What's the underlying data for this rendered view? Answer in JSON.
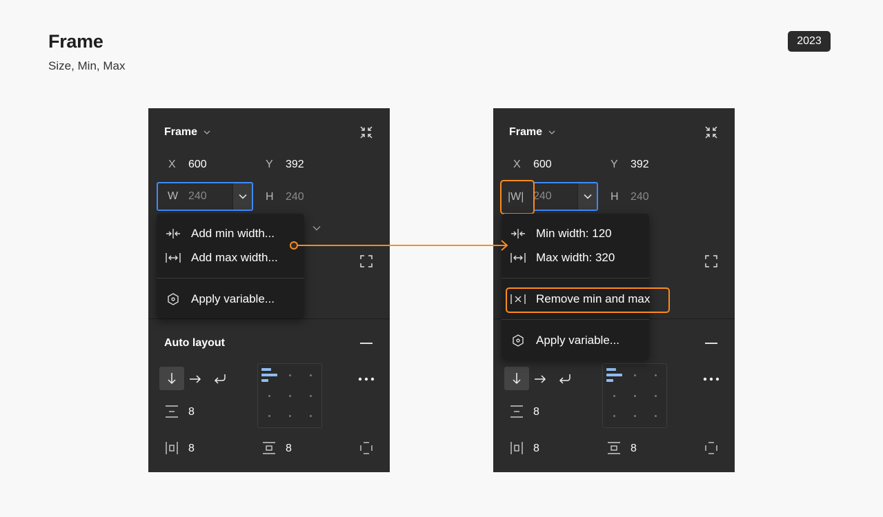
{
  "header": {
    "title": "Frame",
    "subtitle": "Size, Min, Max",
    "year": "2023"
  },
  "frame_section": {
    "title": "Frame",
    "x_label": "X",
    "x_value": "600",
    "y_label": "Y",
    "y_value": "392",
    "h_label": "H",
    "h_value": "240"
  },
  "left_panel": {
    "w_label": "W",
    "w_value": "240",
    "menu": {
      "items": [
        {
          "label": "Add min width...",
          "icon": "min-width-icon"
        },
        {
          "label": "Add max width...",
          "icon": "max-width-icon"
        },
        {
          "label": "Apply variable...",
          "icon": "variable-icon"
        }
      ]
    }
  },
  "right_panel": {
    "w_label": "|W|",
    "w_value": "240",
    "menu": {
      "items": [
        {
          "label": "Min width: 120",
          "icon": "min-width-icon"
        },
        {
          "label": "Max width: 320",
          "icon": "max-width-icon"
        },
        {
          "label": "Remove min and max",
          "icon": "remove-min-max-icon"
        },
        {
          "label": "Apply variable...",
          "icon": "variable-icon"
        }
      ]
    }
  },
  "auto_layout": {
    "title": "Auto layout",
    "gap_value": "8",
    "horizontal_padding": "8",
    "vertical_padding": "8"
  },
  "colors": {
    "panel_bg": "#2c2c2c",
    "menu_bg": "#1e1e1e",
    "focus_blue": "#3d8bff",
    "highlight_orange": "#ff8a1e",
    "alignment_blue": "#8fbcf0"
  }
}
